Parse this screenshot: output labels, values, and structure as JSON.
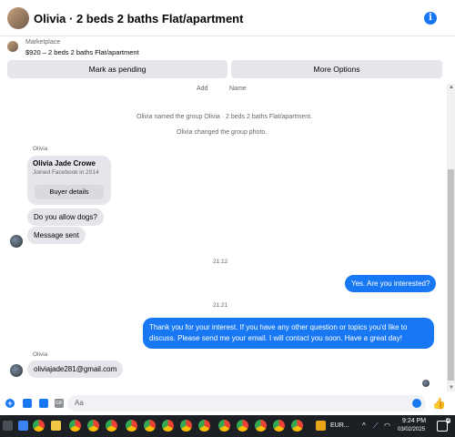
{
  "header": {
    "title": "Olivia · 2 beds 2 baths Flat/apartment"
  },
  "listing": {
    "marketplace_label": "Marketplace",
    "price_title": "$920 – 2 beds 2 baths Flat/apartment",
    "pending_button": "Mark as pending",
    "more_button": "More Options"
  },
  "chat": {
    "add_label": "Add",
    "name_label": "Name",
    "system_1": "Olivia named the group Olivia · 2 beds 2 baths Flat/apartment.",
    "system_2": "Olivia changed the group photo.",
    "sender_label_1": "Olivia",
    "profile_card": {
      "name": "Olivia Jade Crowe",
      "joined": "Joined Facebook in 2014",
      "buyer_details": "Buyer details"
    },
    "msg_dogs": "Do you allow dogs?",
    "msg_sent": "Message sent",
    "time_1": "21:12",
    "reply_1": "Yes. Are you interested?",
    "time_2": "21:21",
    "reply_2_line1": "Thank you for your interest. If you have any other question or topics you'd like to",
    "reply_2_line2": "discuss. Please send me your email. I will contact you soon. Have a great day!",
    "sender_label_2": "Olivia",
    "msg_email": "oliviajade281@gmail.com"
  },
  "composer": {
    "placeholder": "Aa"
  },
  "taskbar": {
    "eur_label": "EUR...",
    "time": "9:24 PM",
    "date": "03/02/2025",
    "notif_count": "4"
  },
  "colors": {
    "accent": "#1877f2",
    "bubble_gray": "#e4e6eb",
    "taskbar": "#1c1f24"
  }
}
